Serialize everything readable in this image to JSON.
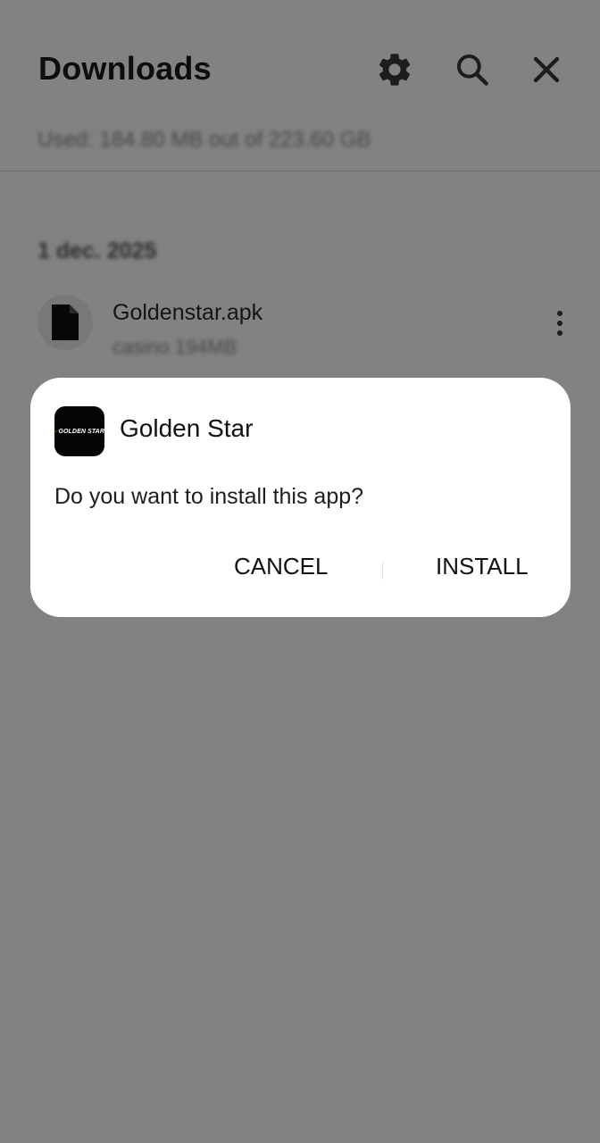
{
  "header": {
    "title": "Downloads",
    "icons": [
      "gear-icon",
      "search-icon",
      "close-icon"
    ]
  },
  "storage": {
    "text": "Used: 184.80 MB out of 223.60 GB"
  },
  "list": {
    "date_header": "1 dec. 2025",
    "items": [
      {
        "name": "Goldenstar.apk",
        "meta": "casino 194MB",
        "icon": "file-icon"
      }
    ]
  },
  "dialog": {
    "app_name": "Golden Star",
    "app_logo_text": "GOLDEN STAR",
    "prompt": "Do you want to install this app?",
    "cancel_label": "CANCEL",
    "install_label": "INSTALL"
  },
  "colors": {
    "scrim": "#00000080",
    "logo_star": "#f2c14e",
    "dialog_bg": "#ffffff"
  }
}
